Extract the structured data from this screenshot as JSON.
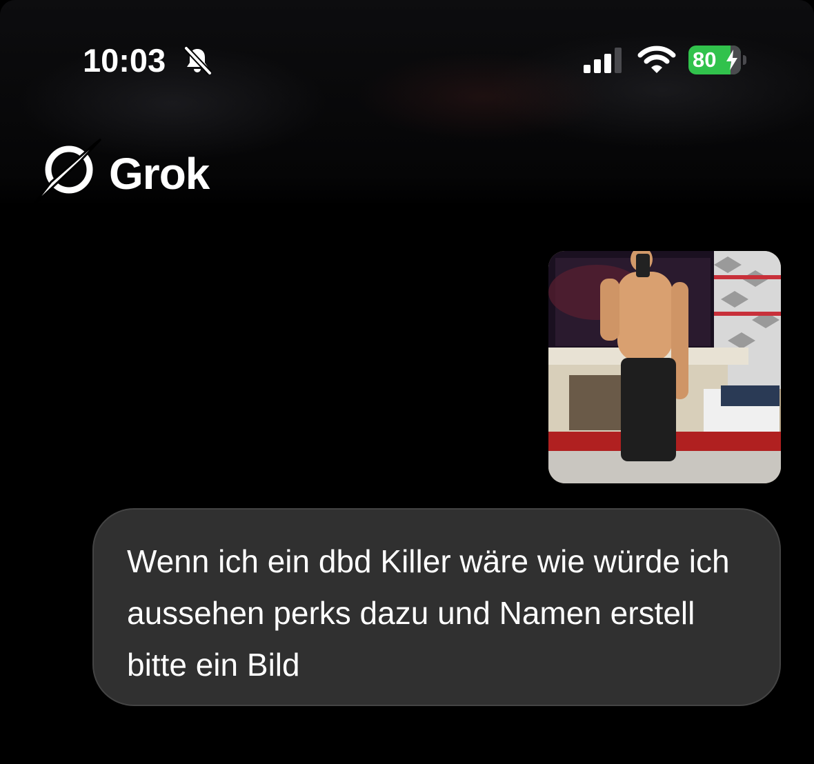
{
  "status_bar": {
    "time": "10:03",
    "battery_percent": "80",
    "battery_level": 0.8,
    "icons": [
      "bell-muted-icon",
      "cellular-signal-icon",
      "wifi-icon",
      "battery-charging-icon"
    ]
  },
  "header": {
    "app_title": "Grok",
    "logo_icon": "grok-logo-icon"
  },
  "conversation": {
    "attachment_icon": "photo-thumbnail",
    "user_message": "Wenn ich ein dbd Killer wäre wie würde ich aussehen perks dazu und Namen erstell bitte ein Bild"
  },
  "colors": {
    "background": "#000000",
    "bubble": "#303030",
    "battery_green": "#31c24c"
  }
}
